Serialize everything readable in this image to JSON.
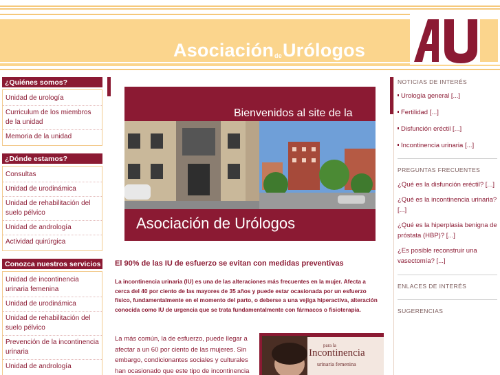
{
  "header": {
    "title_part1": "Asociación",
    "title_de": "de",
    "title_part2": "Urólogos",
    "logo_text": "AU"
  },
  "left_sidebar": {
    "sections": [
      {
        "heading": "¿Quiénes somos?",
        "items": [
          "Unidad de urología",
          "Curriculum de los  miembros de la unidad",
          "Memoria de la unidad"
        ]
      },
      {
        "heading": "¿Dónde estamos?",
        "items": [
          "Consultas",
          "Unidad de urodinámica",
          "Unidad de rehabilitación  del suelo pélvico",
          "Unidad de andrología",
          "Actividad quirúrgica"
        ]
      },
      {
        "heading": "Conozca nuestros servicios",
        "items": [
          "Unidad de incontinencia urinaria femenina",
          "Unidad de urodinámica",
          "Unidad de rehabilitación  del suelo pélvico",
          "Prevención de la  incontinencia urinaria",
          "Unidad de andrología"
        ]
      }
    ]
  },
  "banner": {
    "welcome": "Bienvenidos al site de la",
    "name": "Asociación de Urólogos"
  },
  "main": {
    "title": "El 90% de las IU de esfuerzo se evitan con medidas preventivas",
    "intro": "La incontinencia urinaria (IU) es una de las alteraciones más frecuentes en la mujer. Afecta a cerca del 40 por ciento de las mayores de 35 años y puede estar ocasionada por un esfuerzo físico, fundamentalmente en el momento del parto, o deberse a una vejiga hiperactiva, alteración conocida como IU de urgencia que se trata fundamentalmente con fármacos o fisioterapia.",
    "paragraph": "La más común, la de esfuerzo, puede llegar a afectar a un 60 por ciento de las mujeres. Sin embargo, condicionantes sociales y culturales han ocasionado que este tipo de incontinencia",
    "image_caption_small": "para la",
    "image_caption_big": "Incontinencia",
    "image_caption_sub": "urinaria femenina"
  },
  "right_sidebar": {
    "news_heading": "NOTICIAS DE INTERÉS",
    "news": [
      "Urología general [...]",
      "Fertilidad [...]",
      "Disfunción eréctil [...]",
      "Incontinencia urinaria [...]"
    ],
    "faq_heading": "PREGUNTAS FRECUENTES",
    "faq": [
      "¿Qué es la disfunción eréctil? [...]",
      "¿Qué es la incontinencia urinaria? [...]",
      "¿Qué es la hiperplasia benigna de próstata (HBP)? [...]",
      "¿Es posible reconstruir una vasectomía? [...]"
    ],
    "links_heading": "ENLACES DE INTERÉS",
    "suggest_heading": "SUGERENCIAS"
  },
  "colors": {
    "brand": "#8b1a33",
    "header_band": "#fbd58d",
    "accent_line": "#f5c87a"
  }
}
